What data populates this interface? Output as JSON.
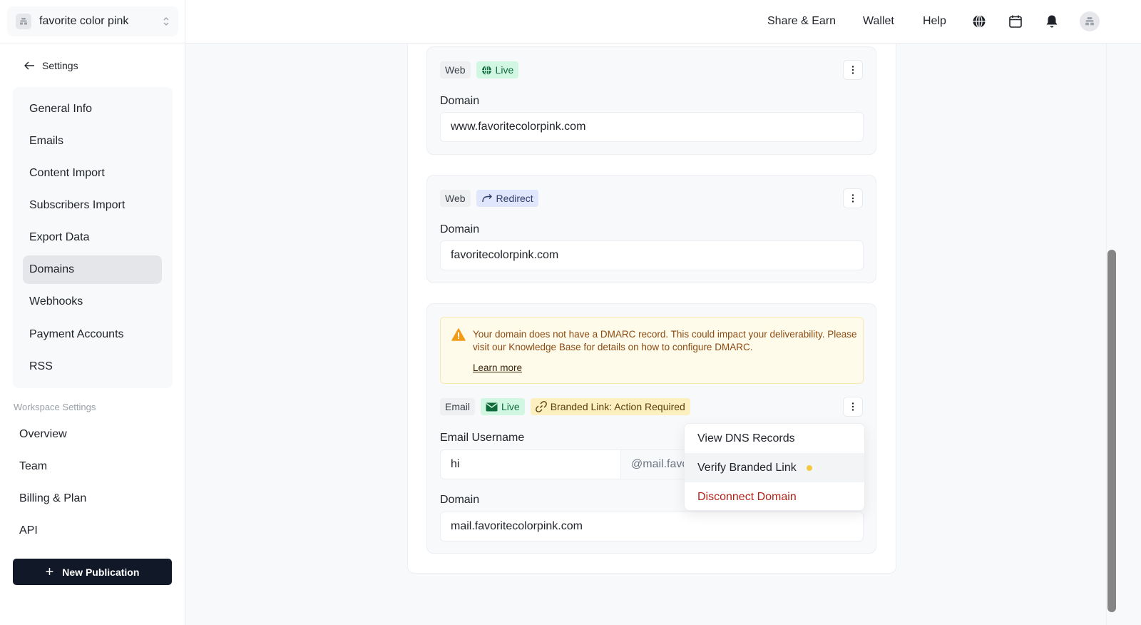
{
  "sidebar": {
    "publication_name": "favorite color pink",
    "back_label": "Settings",
    "nav_items": [
      {
        "label": "General Info"
      },
      {
        "label": "Emails"
      },
      {
        "label": "Content Import"
      },
      {
        "label": "Subscribers Import"
      },
      {
        "label": "Export Data"
      },
      {
        "label": "Domains",
        "active": true
      },
      {
        "label": "Webhooks"
      },
      {
        "label": "Payment Accounts"
      },
      {
        "label": "RSS"
      }
    ],
    "workspace_label": "Workspace Settings",
    "workspace_items": [
      {
        "label": "Overview"
      },
      {
        "label": "Team"
      },
      {
        "label": "Billing & Plan"
      },
      {
        "label": "API"
      }
    ],
    "new_publication_label": "New Publication"
  },
  "topbar": {
    "links": [
      "Share & Earn",
      "Wallet",
      "Help"
    ],
    "icons": [
      "globe-icon",
      "calendar-icon",
      "bell-icon",
      "avatar"
    ]
  },
  "domains": [
    {
      "type_badge": "Web",
      "status_badge": "Live",
      "status_icon": "globe-icon",
      "field_label": "Domain",
      "value": "www.favoritecolorpink.com"
    },
    {
      "type_badge": "Web",
      "status_badge": "Redirect",
      "status_icon": "redirect-arrow-icon",
      "field_label": "Domain",
      "value": "favoritecolorpink.com"
    },
    {
      "alert": {
        "text": "Your domain does not have a DMARC record. This could impact your deliverability. Please visit our Knowledge Base for details on how to configure DMARC.",
        "link": "Learn more"
      },
      "type_badge": "Email",
      "status_badge": "Live",
      "status_icon": "envelope-icon",
      "branded_badge": "Branded Link: Action Required",
      "username_label": "Email Username",
      "username_value": "hi",
      "username_suffix": "@mail.favc",
      "field_label": "Domain",
      "value": "mail.favoritecolorpink.com"
    }
  ],
  "menu": {
    "items": [
      {
        "label": "View DNS Records"
      },
      {
        "label": "Verify Branded Link",
        "indicator_color": "#f5c842"
      },
      {
        "label": "Disconnect Domain",
        "danger": true
      }
    ]
  },
  "colors": {
    "primary_button": "#111827",
    "live_badge": "#d1f7e2",
    "redirect_badge": "#e0e6fb",
    "warning_badge": "#fdf0c0",
    "danger_text": "#b42318"
  }
}
